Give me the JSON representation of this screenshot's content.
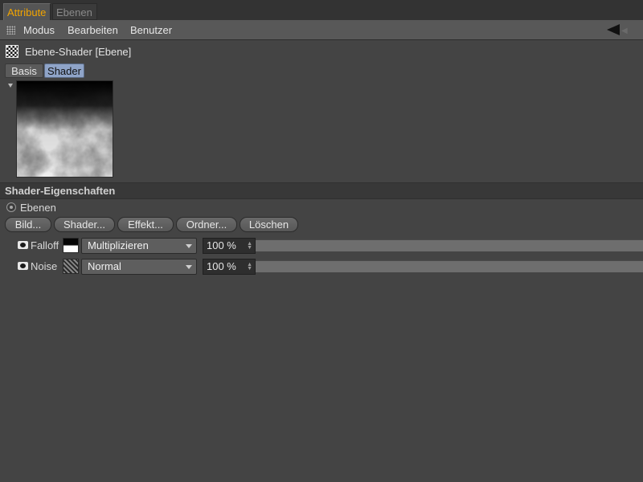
{
  "tabs": [
    {
      "label": "Attribute",
      "active": true
    },
    {
      "label": "Ebenen",
      "active": false
    }
  ],
  "menu": [
    "Modus",
    "Bearbeiten",
    "Benutzer"
  ],
  "object": {
    "title": "Ebene-Shader [Ebene]"
  },
  "subtabs": [
    {
      "label": "Basis",
      "active": false
    },
    {
      "label": "Shader",
      "active": true
    }
  ],
  "section": {
    "title": "Shader-Eigenschaften"
  },
  "radio": {
    "label": "Ebenen",
    "selected": true
  },
  "buttons": [
    "Bild...",
    "Shader...",
    "Effekt...",
    "Ordner...",
    "Löschen"
  ],
  "layers": [
    {
      "name": "Falloff",
      "thumb": "falloff-thumbnail",
      "blend_mode": "Multiplizieren",
      "percent": "100 %",
      "level": 1.0
    },
    {
      "name": "Noise",
      "thumb": "noise-thumbnail",
      "blend_mode": "Normal",
      "percent": "100 %",
      "level": 1.0
    }
  ],
  "colors": {
    "active_tab": "#f2a400",
    "active_subtab": "#8fa4c8",
    "background": "#444444"
  }
}
